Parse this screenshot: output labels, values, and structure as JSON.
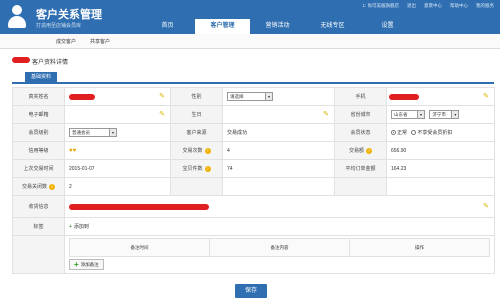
{
  "header": {
    "brand_title": "客户关系管理",
    "brand_sub": "打造用至店铺会员库",
    "nav": [
      "首页",
      "客户管理",
      "营销活动",
      "无线专区",
      "设置"
    ],
    "active_nav_index": 1,
    "toplinks": [
      "1: 尚可美服旗舰店",
      "退出",
      "意景中心",
      "帮助中心",
      "我的服务"
    ]
  },
  "subnav": {
    "items": [
      "成交客户",
      "共享客户"
    ]
  },
  "section": {
    "title_suffix": "客户资料详情"
  },
  "tabs": {
    "basic": "基础资料"
  },
  "form": {
    "rows": [
      {
        "label1": "真实姓名",
        "label2": "性别",
        "gender_select": "请选择",
        "label3": "手机"
      },
      {
        "label1": "电子邮箱",
        "label2": "生日",
        "label3": "省份城市",
        "province": "山东省",
        "city": "济宁市"
      },
      {
        "label1": "会员级别",
        "level_select": "普通会员",
        "label2": "客户来源",
        "source": "交易成功",
        "label3": "会员状态",
        "status_options": [
          "正常",
          "不享受会员折扣"
        ],
        "status_selected": "正常"
      },
      {
        "label1": "信用等级",
        "credit_hearts": "♥♥",
        "label2": "交易次数",
        "trade_count": "4",
        "label3": "交易额",
        "trade_amount": "656.90"
      },
      {
        "label1": "上次交易时间",
        "last_trade": "2015-01-07",
        "label2": "宝贝件数",
        "item_count": "74",
        "label3": "平均订单金额",
        "avg_order": "164.23"
      },
      {
        "label1": "交易关闭数",
        "closed_count": "2"
      },
      {
        "label1": "收货信息"
      },
      {
        "label1": "标签",
        "add_tag": "添加到"
      }
    ],
    "remarks": {
      "headers": [
        "备注时间",
        "备注内容",
        "操作"
      ],
      "add_button": "添加备注"
    }
  },
  "save_button": "保存",
  "colors": {
    "primary": "#2f6fb1",
    "redaction": "#e02020",
    "pencil": "#d9b800"
  }
}
